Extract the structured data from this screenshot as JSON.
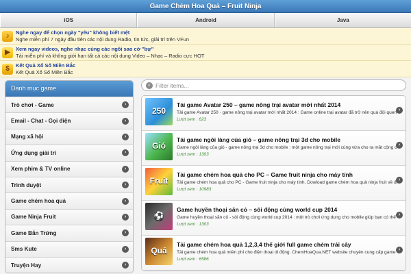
{
  "header": {
    "title": "Game Chém Hoa Quả – Fruit Ninja"
  },
  "nav": {
    "tabs": [
      {
        "label": "iOS"
      },
      {
        "label": "Android"
      },
      {
        "label": "Java"
      }
    ]
  },
  "promos": [
    {
      "title": "Nghe ngay để chọn ngày \"yêu\" không biết mệt",
      "desc": "Nghe miễn phí 7 ngày đầu tiên các nội dung Radio, tin tức, giải trí trên VFun"
    },
    {
      "title": "Xem ngay videos, nghe nhạc cùng các ngôi sao cờ \"bự\"",
      "desc": "Tải miễn phí và không giới hạn tất cả các nội dung Video – Nhạc – Radio cực HOT"
    },
    {
      "title": "Kết Quả Xổ Số Miền Bắc",
      "desc": "Kết Quả Xổ Số Miền Bắc"
    }
  ],
  "sidebar": {
    "title": "Danh mục game",
    "items": [
      {
        "label": "Trò chơi - Game"
      },
      {
        "label": "Email - Chat - Gọi điện"
      },
      {
        "label": "Mạng xã hội"
      },
      {
        "label": "Ứng dụng giải trí"
      },
      {
        "label": "Xem phim & TV online"
      },
      {
        "label": "Trình duyệt"
      },
      {
        "label": "Game chém hoa quả"
      },
      {
        "label": "Game Ninja Fruit"
      },
      {
        "label": "Game Bắn Trứng"
      },
      {
        "label": "Sms Kute"
      },
      {
        "label": "Truyện Hay"
      }
    ]
  },
  "filter": {
    "placeholder": "Filter items..."
  },
  "list": {
    "items": [
      {
        "title": "Tải game Avatar 250 – game nông trại avatar mới nhất 2014",
        "desc": "Tải game Avatar 250 · game nông trại avatar mới nhất 2014 : Game online trại avatar đã trở nên quá đỗi quen thuộc với",
        "views": "Lượt xem : 623",
        "thumb_text": "250"
      },
      {
        "title": "Tải game ngôi làng của gió – game nông trại 3d cho mobile",
        "desc": "Game ngôi làng của gió - game nông trại 3d cho mobile :  một game nông trại mới cùng vừa cho ra mắt cộng đồng các",
        "views": "Lượt xem : 1303",
        "thumb_text": "Gió"
      },
      {
        "title": "Tải game chém hoa quả cho PC – Game fruit ninja cho máy tính",
        "desc": "Tải game chém hoa quả cho PC - Game fruit ninja cho máy tính. Dowload game chém hoa quả ninja fruit về điện thoại",
        "views": "Lượt xem : 10983",
        "thumb_text": "Fruit"
      },
      {
        "title": "Game huyền thoại săn cỏ – sôi động cùng world cup 2014",
        "desc": "Game huyền thoại săn cỏ - sôi động cùng world cup 2014 : một trò chơi ứng dụng cho mobile giúp bạn có thể quản lý",
        "views": "Lượt xem : 1303",
        "thumb_text": "⚽"
      },
      {
        "title": "Tải game chém hoa quả 1,2,3,4 thế giới full game chém trái cây",
        "desc": "Tải game chém hoa quả miễn phí cho điện thoại di động. ChemHoaQua.NET website chuyên cung cấp game chém hoa",
        "views": "Lượt xem : 6586",
        "thumb_text": "Quả"
      }
    ]
  },
  "icons": {
    "chevron": "chevron-right-icon",
    "search": "search-icon"
  }
}
